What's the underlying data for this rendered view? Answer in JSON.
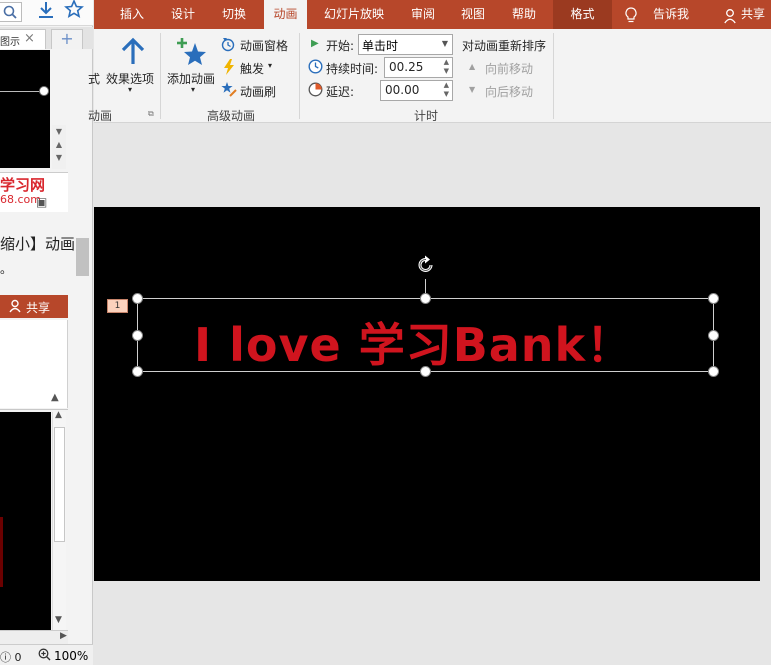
{
  "left_pane": {
    "tab1_label": "图示",
    "tab_close": "×",
    "tab_add": "+",
    "site_name": "学习网",
    "site_url": "68.com",
    "body_line1": "缩小】动画",
    "body_line2": "。",
    "share_label": "共享",
    "status_comments": "0",
    "zoom": "100%"
  },
  "ribbon": {
    "tabs": [
      "插入",
      "设计",
      "切换",
      "动画",
      "幻灯片放映",
      "审阅",
      "视图",
      "帮助",
      "格式"
    ],
    "active_tab": "动画",
    "tell_me": "告诉我",
    "share": "共享",
    "partial_label": "式",
    "effect_options": "效果选项",
    "add_animation": "添加动画",
    "animation_pane": "动画窗格",
    "trigger": "触发",
    "animation_painter": "动画刷",
    "group_partial": "动画",
    "group_advanced": "高级动画",
    "start_label": "开始:",
    "start_value": "单击时",
    "duration_label": "持续时间:",
    "duration_value": "00.25",
    "delay_label": "延迟:",
    "delay_value": "00.00",
    "group_timing": "计时",
    "reorder_title": "对动画重新排序",
    "move_earlier": "向前移动",
    "move_later": "向后移动"
  },
  "slide": {
    "text": "I love 学习Bank！",
    "text_color": "#d0141e",
    "background": "#000000",
    "animation_tag": "1"
  },
  "colors": {
    "accent": "#b7472a",
    "format_tab": "#9b3a20"
  }
}
